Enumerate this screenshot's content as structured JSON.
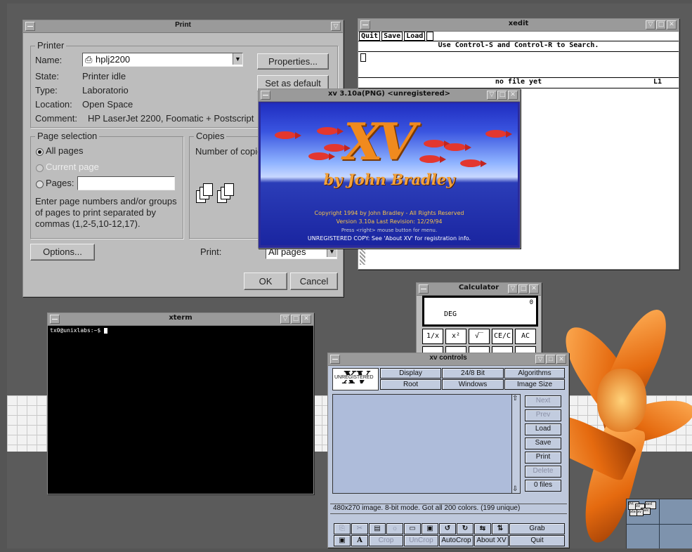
{
  "print_dialog": {
    "title": "Print",
    "printer_group": "Printer",
    "name_label": "Name:",
    "name_value": "hplj2200",
    "state_label": "State:",
    "state_value": "Printer idle",
    "type_label": "Type:",
    "type_value": "Laboratorio",
    "location_label": "Location:",
    "location_value": "Open Space",
    "comment_label": "Comment:",
    "comment_value": "HP LaserJet 2200, Foomatic + Postscript",
    "properties_button": "Properties...",
    "set_default_button": "Set as default",
    "page_selection_group": "Page selection",
    "all_pages": "All pages",
    "current_page": "Current page",
    "pages_label": "Pages:",
    "pages_help": "Enter page numbers and/or groups of pages to print separated by commas (1,2-5,10-12,17).",
    "copies_group": "Copies",
    "copies_label": "Number of copie",
    "options_button": "Options...",
    "print_label": "Print:",
    "print_select": "All pages",
    "ok_button": "OK",
    "cancel_button": "Cancel"
  },
  "xedit": {
    "title": "xedit",
    "quit": "Quit",
    "save": "Save",
    "load": "Load",
    "message": "Use Control-S and Control-R to Search.",
    "status": "no file yet",
    "line": "L1"
  },
  "xv_splash": {
    "title": "xv 3.10a(PNG) <unregistered>",
    "logo": "XV",
    "byline": "by John Bradley",
    "copyright": "Copyright 1994 by John Bradley - All Rights Reserved",
    "version": "Version 3.10a     Last Revision: 12/29/94",
    "press": "Press <right> mouse button for menu.",
    "unregistered": "UNREGISTERED COPY:  See 'About XV' for registration info."
  },
  "xterm": {
    "title": "xterm",
    "prompt": "tx0@unixlabs:~$ "
  },
  "calculator": {
    "title": "Calculator",
    "display": "0",
    "mode": "DEG",
    "buttons": [
      "1/x",
      "x²",
      "√‾",
      "CE/C",
      "AC"
    ]
  },
  "xv_controls": {
    "title": "xv controls",
    "badge": "UNREGISTERED",
    "top_buttons": [
      "Display",
      "24/8 Bit",
      "Algorithms",
      "Root",
      "Windows",
      "Image Size"
    ],
    "side_buttons": [
      "Next",
      "Prev",
      "Load",
      "Save",
      "Print",
      "Delete"
    ],
    "file_count": "0 files",
    "status": "480x270 image. 8-bit mode. Got all 200 colors. (199 unique)",
    "bottom_text_buttons": [
      "Grab",
      "Crop",
      "UnCrop",
      "AutoCrop",
      "About XV",
      "Quit"
    ]
  },
  "pager": {
    "labels": [
      "Prt",
      "xv",
      "xte",
      "xed",
      "Calc",
      "xv"
    ]
  }
}
